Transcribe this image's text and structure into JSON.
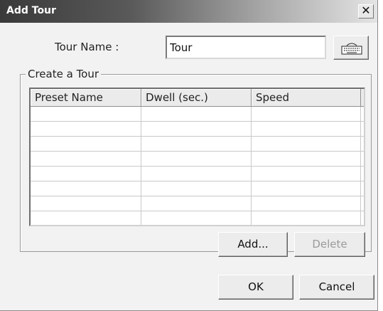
{
  "window": {
    "title": "Add Tour",
    "close_glyph": "✕"
  },
  "form": {
    "tour_name_label": "Tour Name :",
    "tour_name_value": "Tour",
    "keyboard_icon": "keyboard-icon"
  },
  "group": {
    "legend": "Create a Tour"
  },
  "table": {
    "columns": [
      "Preset Name",
      "Dwell (sec.)",
      "Speed"
    ],
    "rows": [
      [
        "",
        "",
        ""
      ],
      [
        "",
        "",
        ""
      ],
      [
        "",
        "",
        ""
      ],
      [
        "",
        "",
        ""
      ],
      [
        "",
        "",
        ""
      ],
      [
        "",
        "",
        ""
      ],
      [
        "",
        "",
        ""
      ],
      [
        "",
        "",
        ""
      ]
    ]
  },
  "buttons": {
    "add": "Add...",
    "delete": "Delete",
    "ok": "OK",
    "cancel": "Cancel"
  }
}
